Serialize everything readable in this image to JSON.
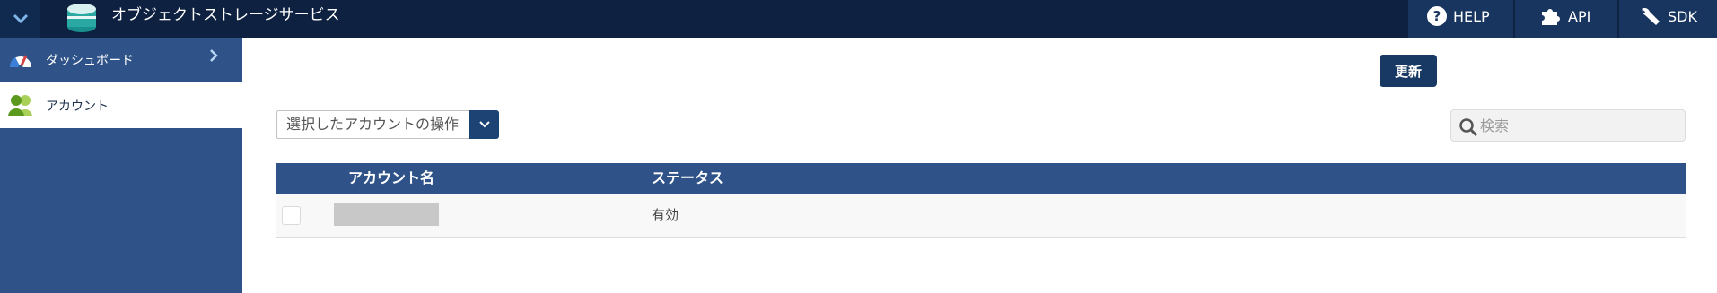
{
  "header": {
    "app_title": "オブジェクトストレージサービス",
    "nav": [
      {
        "label": "HELP",
        "icon": "help-circle-icon"
      },
      {
        "label": "API",
        "icon": "puzzle-icon"
      },
      {
        "label": "SDK",
        "icon": "wrench-icon"
      }
    ]
  },
  "sidebar": {
    "items": [
      {
        "label": "ダッシュボード",
        "icon": "gauge-icon",
        "active": false
      },
      {
        "label": "アカウント",
        "icon": "users-icon",
        "active": true
      }
    ]
  },
  "toolbar": {
    "refresh_label": "更新",
    "action_select_label": "選択したアカウントの操作",
    "search_placeholder": "検索"
  },
  "table": {
    "columns": [
      "アカウント名",
      "ステータス"
    ],
    "rows": [
      {
        "name": "",
        "status": "有効",
        "checked": false
      }
    ]
  },
  "colors": {
    "topbar": "#0e2140",
    "accent": "#2f5388",
    "button": "#173963"
  }
}
